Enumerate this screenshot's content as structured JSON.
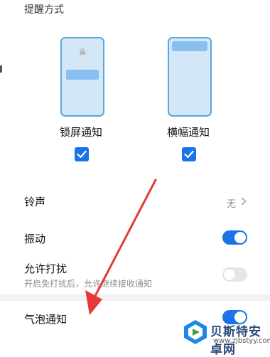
{
  "section": {
    "title": "提醒方式"
  },
  "modes": [
    {
      "label": "锁屏通知",
      "checked": true
    },
    {
      "label": "横幅通知",
      "checked": true
    }
  ],
  "settings": {
    "ringtone": {
      "label": "铃声",
      "value": "无"
    },
    "vibration": {
      "label": "振动",
      "enabled": true
    },
    "allow_dnd": {
      "label": "允许打扰",
      "description": "开启免打扰后，允许继续接收通知",
      "enabled": false
    },
    "bubble": {
      "label": "气泡通知",
      "enabled": true
    }
  },
  "watermark": {
    "title": "贝斯特安卓网",
    "url": "www.zjbstyy.com"
  },
  "colors": {
    "accent": "#1a73e8",
    "annotation_arrow": "#e53935",
    "phone_outline": "#5ba6da"
  },
  "icons": [
    "lock-icon",
    "check-icon",
    "chevron-right-icon",
    "toggle-switch",
    "red-arrow-annotation"
  ]
}
